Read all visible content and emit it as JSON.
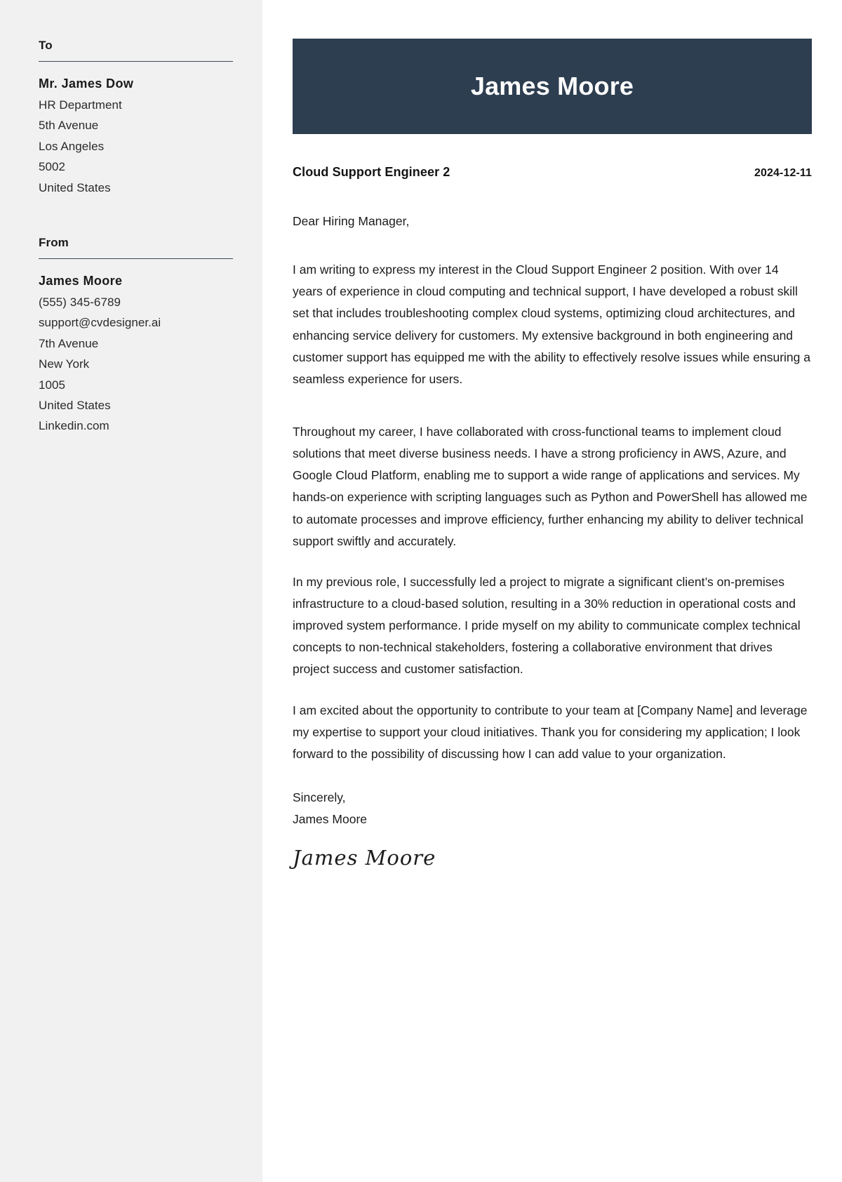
{
  "theme": {
    "sidebar_bg": "#f1f1f1",
    "banner_bg": "#2d3e50",
    "page_bg": "#ffffff",
    "text_color": "#1c1c1c",
    "rule_color": "#3c4858"
  },
  "sidebar": {
    "to": {
      "heading": "To",
      "name": "Mr. James Dow",
      "lines": [
        "HR Department",
        "5th Avenue",
        "Los Angeles",
        "5002",
        "United States"
      ]
    },
    "from": {
      "heading": "From",
      "name": "James Moore",
      "lines": [
        "(555) 345-6789",
        "support@cvdesigner.ai",
        "7th Avenue",
        "New York",
        "1005",
        "United States",
        "Linkedin.com"
      ]
    }
  },
  "letter": {
    "banner_name": "James Moore",
    "job_title": "Cloud Support Engineer 2",
    "date": "2024-12-11",
    "salutation": "Dear Hiring Manager,",
    "paragraphs": [
      "I am writing to express my interest in the Cloud Support Engineer 2 position. With over 14 years of experience in cloud computing and technical support, I have developed a robust skill set that includes troubleshooting complex cloud systems, optimizing cloud architectures, and enhancing service delivery for customers. My extensive background in both engineering and customer support has equipped me with the ability to effectively resolve issues while ensuring a seamless experience for users.",
      "Throughout my career, I have collaborated with cross-functional teams to implement cloud solutions that meet diverse business needs. I have a strong proficiency in AWS, Azure, and Google Cloud Platform, enabling me to support a wide range of applications and services. My hands-on experience with scripting languages such as Python and PowerShell has allowed me to automate processes and improve efficiency, further enhancing my ability to deliver technical support swiftly and accurately.",
      "In my previous role, I successfully led a project to migrate a significant client’s on-premises infrastructure to a cloud-based solution, resulting in a 30% reduction in operational costs and improved system performance. I pride myself on my ability to communicate complex technical concepts to non-technical stakeholders, fostering a collaborative environment that drives project success and customer satisfaction.",
      "I am excited about the opportunity to contribute to your team at [Company Name] and leverage my expertise to support your cloud initiatives. Thank you for considering my application; I look forward to the possibility of discussing how I can add value to your organization."
    ],
    "closing_word": "Sincerely,",
    "closing_name": "James Moore",
    "signature": "James Moore"
  }
}
